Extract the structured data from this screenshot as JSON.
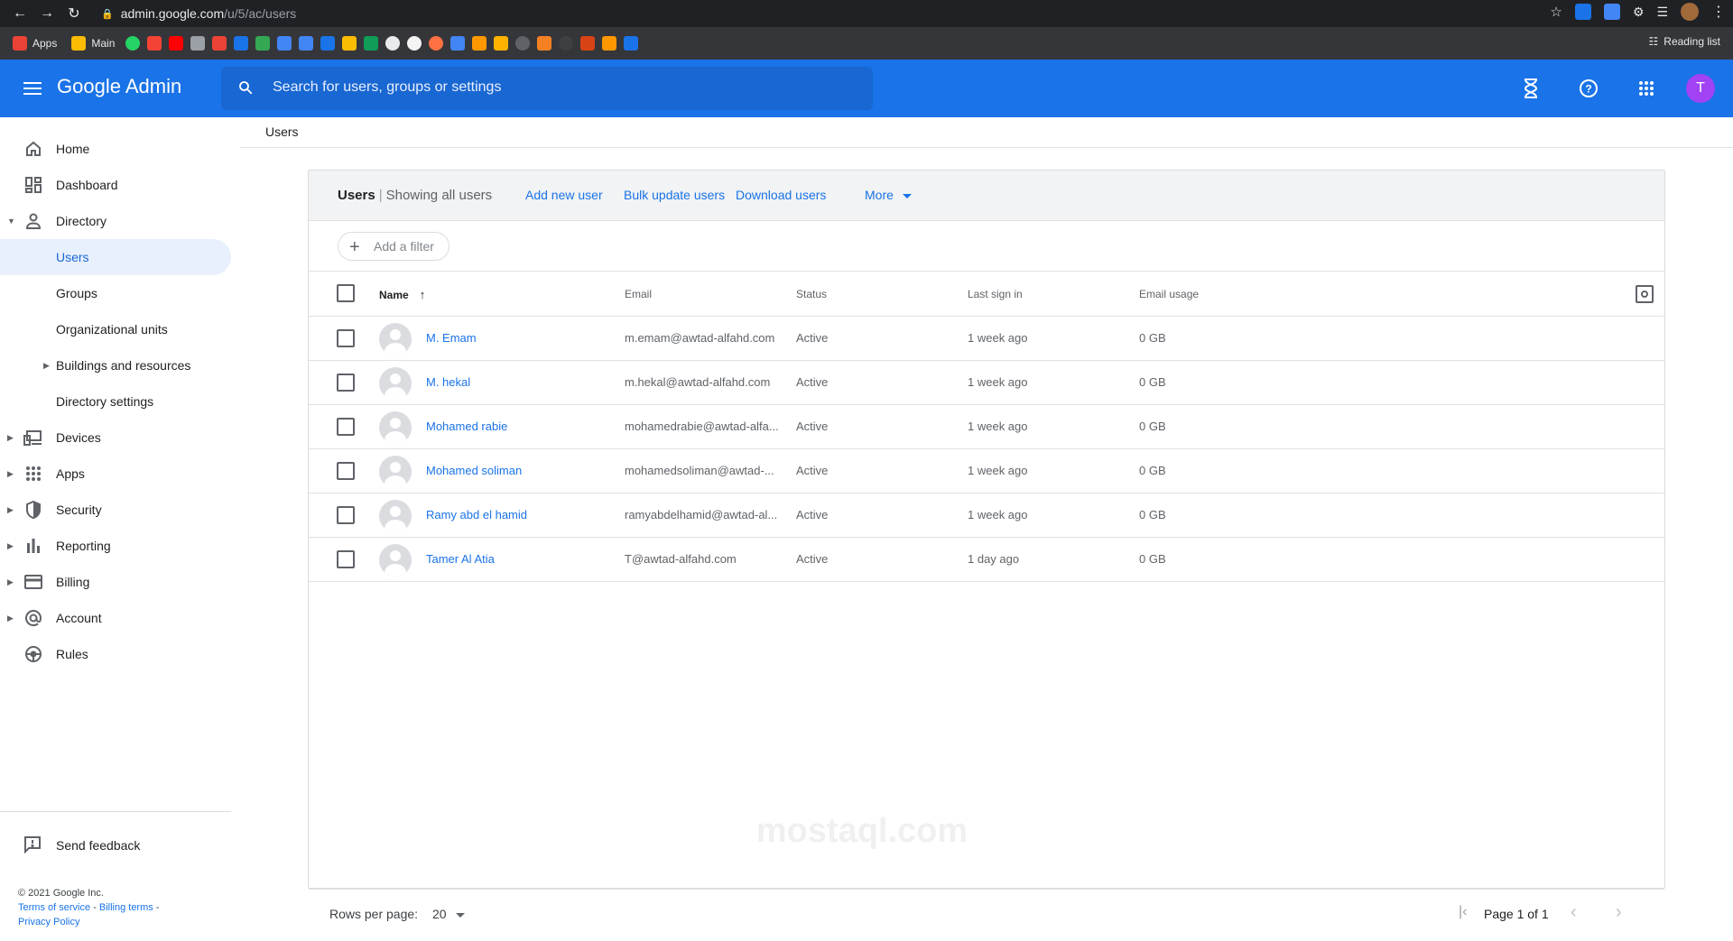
{
  "browser": {
    "url_host": "admin.google.com",
    "url_path": "/u/5/ac/users",
    "bookmarks": [
      {
        "label": "Apps",
        "color": "#ea4335"
      },
      {
        "label": "Main",
        "color": "#fbbc04"
      }
    ],
    "reading_list": "Reading list"
  },
  "header": {
    "brand": "Google Admin",
    "search_placeholder": "Search for users, groups or settings",
    "avatar_letter": "T",
    "accent": "#1a73e8"
  },
  "sidebar": {
    "items": [
      {
        "label": "Home",
        "icon": "home-icon"
      },
      {
        "label": "Dashboard",
        "icon": "dashboard-icon"
      },
      {
        "label": "Directory",
        "icon": "person-icon"
      },
      {
        "label": "Users"
      },
      {
        "label": "Groups"
      },
      {
        "label": "Organizational units"
      },
      {
        "label": "Buildings and resources"
      },
      {
        "label": "Directory settings"
      },
      {
        "label": "Devices",
        "icon": "devices-icon"
      },
      {
        "label": "Apps",
        "icon": "apps-grid-icon"
      },
      {
        "label": "Security",
        "icon": "shield-icon"
      },
      {
        "label": "Reporting",
        "icon": "bar-chart-icon"
      },
      {
        "label": "Billing",
        "icon": "credit-card-icon"
      },
      {
        "label": "Account",
        "icon": "at-sign-icon"
      },
      {
        "label": "Rules",
        "icon": "rules-icon"
      }
    ],
    "feedback": "Send feedback",
    "footer": {
      "copyright": "© 2021 Google Inc.",
      "terms": "Terms of service",
      "billing_terms": "Billing terms",
      "privacy": "Privacy Policy"
    }
  },
  "breadcrumb": "Users",
  "card": {
    "title": "Users",
    "subtitle": "Showing all users",
    "actions": {
      "add": "Add new user",
      "bulk": "Bulk update users",
      "download": "Download users",
      "more": "More"
    },
    "filter": "Add a filter",
    "columns": {
      "name": "Name",
      "email": "Email",
      "status": "Status",
      "last_sign_in": "Last sign in",
      "email_usage": "Email usage"
    },
    "rows": [
      {
        "name": "M. Emam",
        "email": "m.emam@awtad-alfahd.com",
        "status": "Active",
        "last": "1 week ago",
        "usage": "0 GB"
      },
      {
        "name": "M. hekal",
        "email": "m.hekal@awtad-alfahd.com",
        "status": "Active",
        "last": "1 week ago",
        "usage": "0 GB"
      },
      {
        "name": "Mohamed rabie",
        "email": "mohamedrabie@awtad-alfa...",
        "status": "Active",
        "last": "1 week ago",
        "usage": "0 GB"
      },
      {
        "name": "Mohamed soliman",
        "email": "mohamedsoliman@awtad-...",
        "status": "Active",
        "last": "1 week ago",
        "usage": "0 GB"
      },
      {
        "name": "Ramy abd el hamid",
        "email": "ramyabdelhamid@awtad-al...",
        "status": "Active",
        "last": "1 week ago",
        "usage": "0 GB"
      },
      {
        "name": "Tamer Al Atia",
        "email": "T@awtad-alfahd.com",
        "status": "Active",
        "last": "1 day ago",
        "usage": "0 GB"
      }
    ],
    "rows_per_page_label": "Rows per page:",
    "rows_per_page": "20",
    "page_text": "Page 1 of 1"
  },
  "watermark": "mostaql.com"
}
